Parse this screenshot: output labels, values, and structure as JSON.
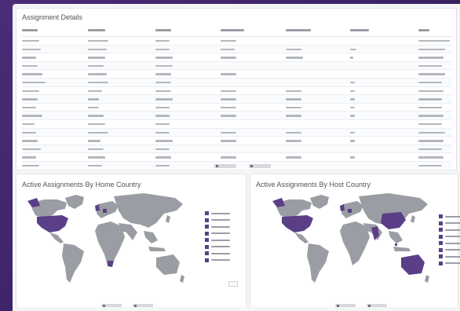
{
  "assignments": {
    "title": "Assignment Details",
    "column_count": 7,
    "row_count": 16,
    "controls": [
      "",
      ""
    ]
  },
  "home_country_map": {
    "title": "Active Assignments By Home Country",
    "highlight_color": "#5a3f86",
    "land_color": "#9a9da3",
    "legend_items": [
      "",
      "",
      "",
      "",
      "",
      "",
      "",
      ""
    ],
    "controls": [
      "",
      ""
    ]
  },
  "host_country_map": {
    "title": "Active Assignments By Host Country",
    "highlight_color": "#5a3f86",
    "land_color": "#9a9da3",
    "legend_items": [
      "",
      "",
      "",
      "",
      "",
      "",
      "",
      ""
    ],
    "controls": [
      "",
      ""
    ]
  },
  "theme": {
    "frame_color": "#3e2466",
    "panel_background": "#ffffff",
    "screen_background": "#f4f5f7"
  }
}
